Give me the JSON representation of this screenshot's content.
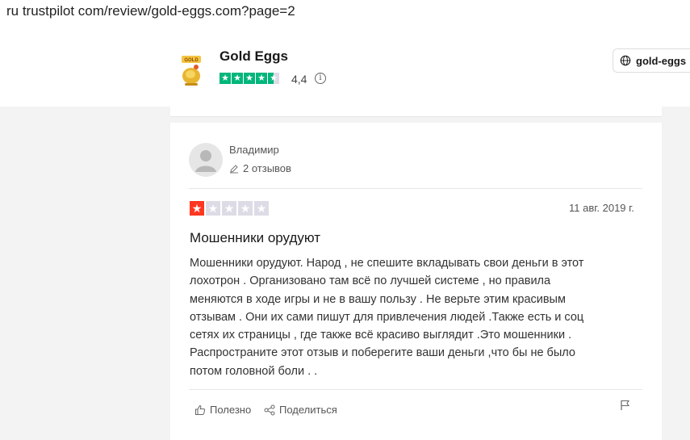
{
  "browser": {
    "url": "ru trustpilot com/review/gold-eggs.com?page=2"
  },
  "company": {
    "name": "Gold Eggs",
    "rating": "4,4",
    "stars": 4.5,
    "info_icon": "info-icon",
    "website_label": "gold-eggs"
  },
  "review": {
    "reviewer_name": "Владимир",
    "review_count": "2 отзывов",
    "rating": 1,
    "date": "11 авг. 2019 г.",
    "title": "Мошенники орудуют",
    "body_lines": [
      "Мошенники орудуют. Народ , не спешите вкладывать свои деньги в этот",
      "лохотрон . Организовано там всё по лучшей системе , но правила",
      "меняются в ходе игры и не в вашу пользу . Не верьте этим красивым",
      "отзывам . Они их сами пишут для привлечения людей .Также есть и соц",
      "сетях их страницы , где также всё красиво выглядит .Это мошенники .",
      "Распространите этот отзыв и поберегите ваши деньги ,что бы не было",
      "потом головной боли . ."
    ],
    "useful_label": "Полезно",
    "share_label": "Поделиться"
  },
  "colors": {
    "trustpilot_green": "#00b67a",
    "one_star_red": "#ff3722",
    "empty_star": "#dcdce6"
  }
}
